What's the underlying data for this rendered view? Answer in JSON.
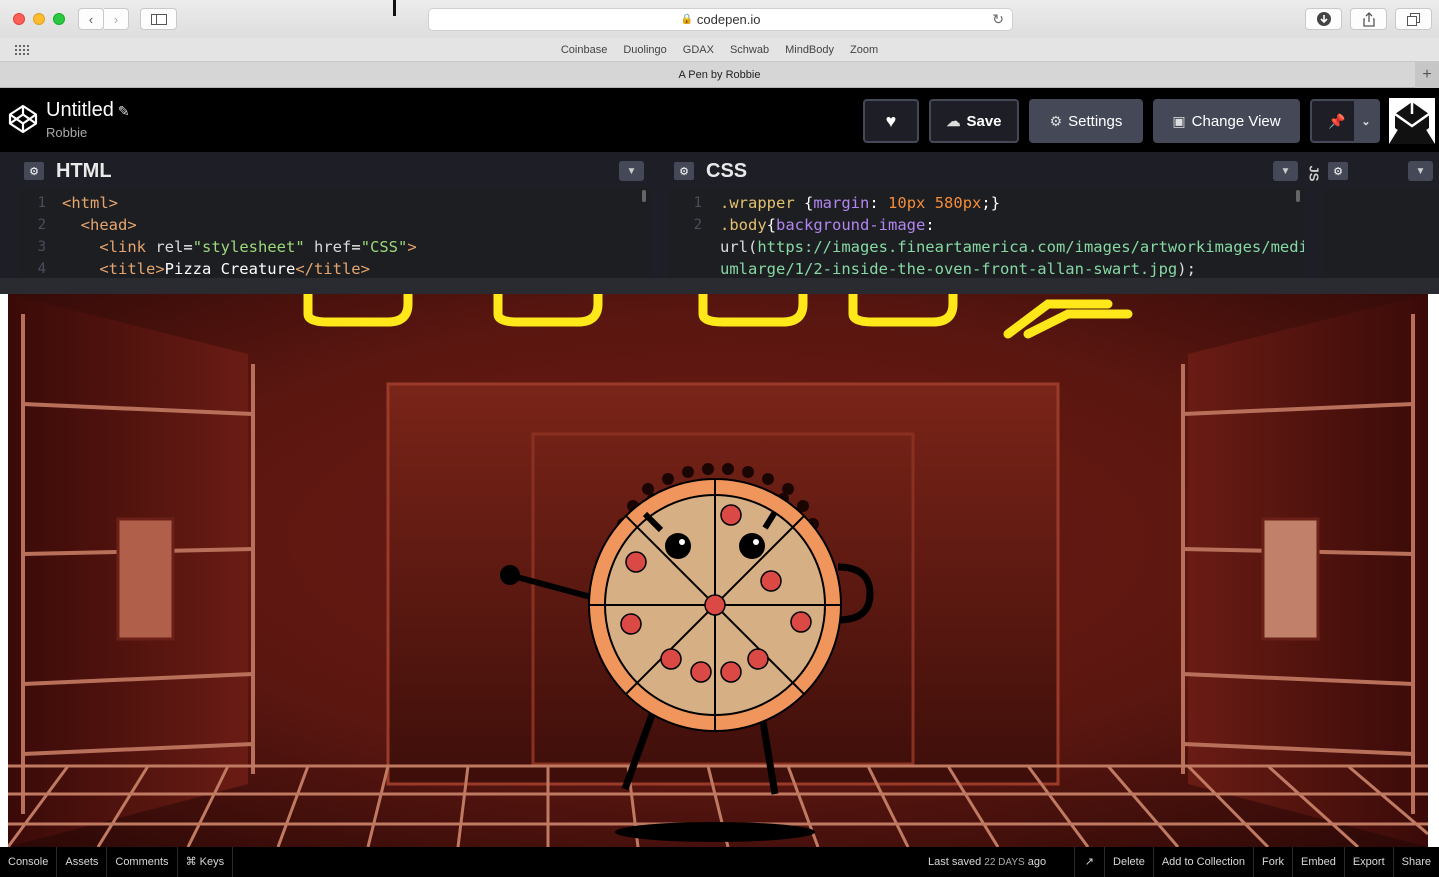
{
  "browser": {
    "url": "codepen.io",
    "tab_title": "A Pen by Robbie",
    "favorites": [
      "Coinbase",
      "Duolingo",
      "GDAX",
      "Schwab",
      "MindBody",
      "Zoom"
    ]
  },
  "header": {
    "title": "Untitled",
    "author": "Robbie",
    "save_label": "Save",
    "settings_label": "Settings",
    "change_view_label": "Change View"
  },
  "html_pane": {
    "title": "HTML",
    "line_numbers": [
      "1",
      "2",
      "3",
      "4"
    ]
  },
  "css_pane": {
    "title": "CSS",
    "line_numbers": [
      "1",
      "2"
    ]
  },
  "js_pane": {
    "title": "JS"
  },
  "footer": {
    "left": [
      "Console",
      "Assets",
      "Comments",
      "⌘ Keys"
    ],
    "saved_prefix": "Last saved",
    "saved_time": "22 DAYS",
    "saved_suffix": "ago",
    "right": [
      "Delete",
      "Add to Collection",
      "Fork",
      "Embed",
      "Export",
      "Share"
    ]
  },
  "colors": {
    "codepen_bg": "#1e1f26",
    "button_gray": "#444857",
    "pizza_crust": "#f0965d",
    "pizza_cheese": "#d6b084",
    "pepperoni": "#db4944",
    "oven_red": "#7a1a10"
  }
}
